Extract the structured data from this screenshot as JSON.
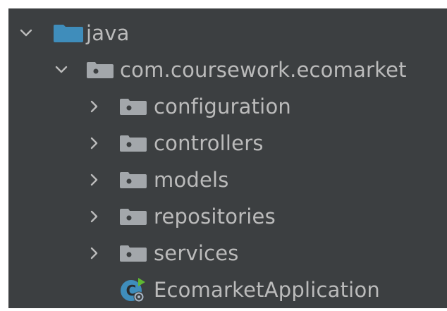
{
  "tree": {
    "root": {
      "label": "java",
      "expanded": true,
      "icon": "source-root-folder-icon"
    },
    "package": {
      "label": "com.coursework.ecomarket",
      "expanded": true,
      "icon": "package-folder-icon"
    },
    "children": [
      {
        "label": "configuration",
        "expanded": false,
        "icon": "package-folder-icon"
      },
      {
        "label": "controllers",
        "expanded": false,
        "icon": "package-folder-icon"
      },
      {
        "label": "models",
        "expanded": false,
        "icon": "package-folder-icon"
      },
      {
        "label": "repositories",
        "expanded": false,
        "icon": "package-folder-icon"
      },
      {
        "label": "services",
        "expanded": false,
        "icon": "package-folder-icon"
      }
    ],
    "app_class": {
      "label": "EcomarketApplication",
      "icon": "spring-boot-class-icon"
    }
  },
  "colors": {
    "background": "#3c3f41",
    "text": "#bbbbbb",
    "source_folder": "#3f8dbb",
    "package_folder": "#a3a7ab",
    "arrow": "#bbbbbb"
  }
}
